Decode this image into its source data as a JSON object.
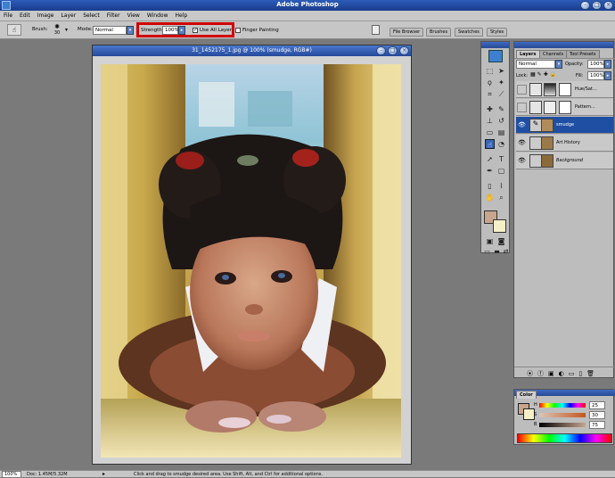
{
  "app": {
    "title": "Adobe Photoshop"
  },
  "menubar": {
    "items": [
      "File",
      "Edit",
      "Image",
      "Layer",
      "Select",
      "Filter",
      "View",
      "Window",
      "Help"
    ]
  },
  "options": {
    "brush_label": "Brush:",
    "brush_size": "30",
    "mode_label": "Mode:",
    "mode_value": "Normal",
    "strength_label": "Strength:",
    "strength_value": "100%",
    "use_all_layers_label": "Use All Layers",
    "use_all_layers_checked": true,
    "finger_painting_label": "Finger Painting",
    "finger_painting_checked": false
  },
  "palette_well": {
    "tabs": [
      "File Browser",
      "Brushes",
      "Swatches",
      "Styles"
    ]
  },
  "document": {
    "title": "31_1452175_1.jpg @ 100% (smudge, RGB#)"
  },
  "layers_panel": {
    "tabs": [
      "Layers",
      "Channels",
      "Tool Presets"
    ],
    "blend_mode": "Normal",
    "opacity_label": "Opacity:",
    "opacity_value": "100%",
    "lock_label": "Lock:",
    "fill_label": "Fill:",
    "fill_value": "100%",
    "layers": [
      {
        "name": "Hue/Sat...",
        "visible": false,
        "selected": false
      },
      {
        "name": "Pattern...",
        "visible": false,
        "selected": false
      },
      {
        "name": "smudge",
        "visible": true,
        "selected": true
      },
      {
        "name": "Art History",
        "visible": true,
        "selected": false
      },
      {
        "name": "Background",
        "visible": true,
        "selected": false
      }
    ]
  },
  "color_panel": {
    "title": "Color",
    "h_label": "H",
    "s_label": "S",
    "b_label": "B",
    "h_value": "25",
    "s_value": "30",
    "b_value": "75",
    "foreground": "#c8a58e",
    "background": "#f5f0c8"
  },
  "statusbar": {
    "zoom": "100%",
    "doc_info": "Doc: 1.45M/5.32M",
    "hint": "Click and drag to smudge desired area. Use Shift, Alt, and Ctrl for additional options."
  },
  "colors": {
    "accent": "#2c5cb8",
    "highlight_box": "#d10000",
    "selected_layer": "#1f4fa3"
  }
}
